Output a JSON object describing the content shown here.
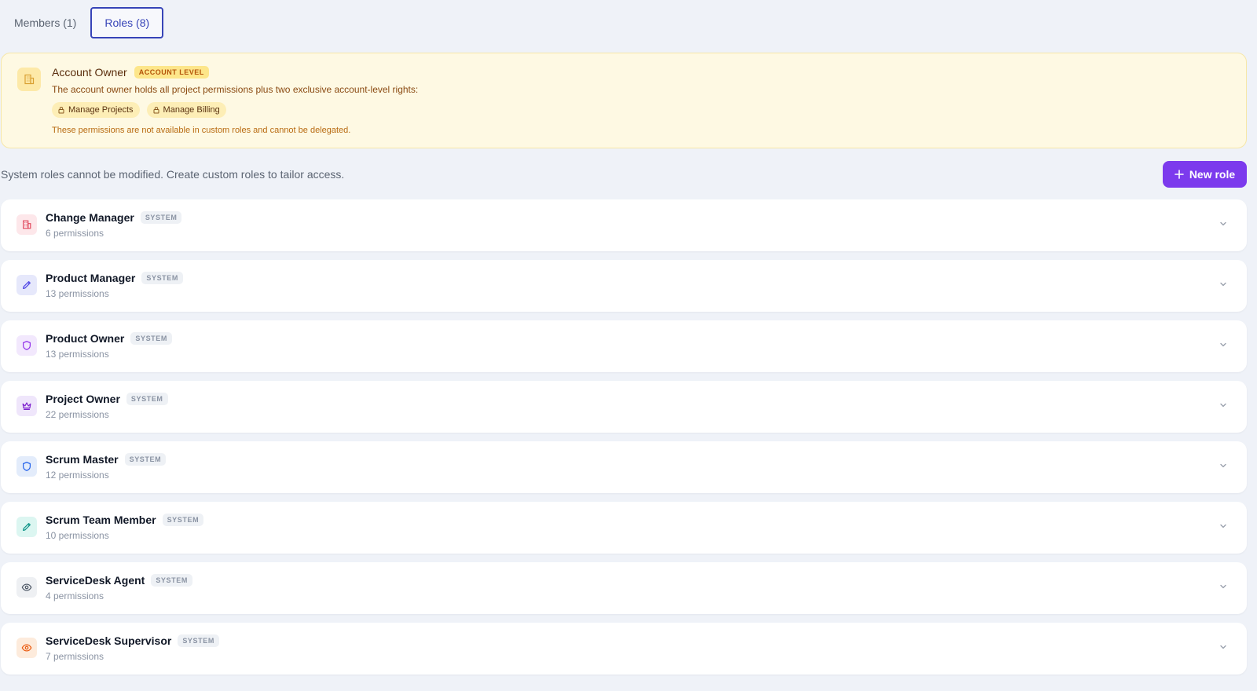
{
  "tabs": [
    {
      "label": "Members (1)",
      "active": false
    },
    {
      "label": "Roles (8)",
      "active": true
    }
  ],
  "account_owner": {
    "title": "Account Owner",
    "badge": "ACCOUNT LEVEL",
    "description": "The account owner holds all project permissions plus two exclusive account-level rights:",
    "rights": [
      "Manage Projects",
      "Manage Billing"
    ],
    "note": "These permissions are not available in custom roles and cannot be delegated.",
    "icon": "building-icon"
  },
  "subheader": "System roles cannot be modified. Create custom roles to tailor access.",
  "new_role_button": "New role",
  "roles": [
    {
      "name": "Change Manager",
      "badge": "SYSTEM",
      "permissions": "6 permissions",
      "icon": "building-icon",
      "icon_color": "#e0455a",
      "icon_bg": "#fde7ea"
    },
    {
      "name": "Product Manager",
      "badge": "SYSTEM",
      "permissions": "13 permissions",
      "icon": "pencil-icon",
      "icon_color": "#4f46e5",
      "icon_bg": "#e6e8fb"
    },
    {
      "name": "Product Owner",
      "badge": "SYSTEM",
      "permissions": "13 permissions",
      "icon": "shield-icon",
      "icon_color": "#9333ea",
      "icon_bg": "#f2e8fd"
    },
    {
      "name": "Project Owner",
      "badge": "SYSTEM",
      "permissions": "22 permissions",
      "icon": "crown-icon",
      "icon_color": "#7e22ce",
      "icon_bg": "#efe6fb"
    },
    {
      "name": "Scrum Master",
      "badge": "SYSTEM",
      "permissions": "12 permissions",
      "icon": "shield-icon",
      "icon_color": "#2563eb",
      "icon_bg": "#e3ecfb"
    },
    {
      "name": "Scrum Team Member",
      "badge": "SYSTEM",
      "permissions": "10 permissions",
      "icon": "pencil-icon",
      "icon_color": "#0d9488",
      "icon_bg": "#dcf6f1"
    },
    {
      "name": "ServiceDesk Agent",
      "badge": "SYSTEM",
      "permissions": "4 permissions",
      "icon": "eye-icon",
      "icon_color": "#4b5563",
      "icon_bg": "#eef0f3"
    },
    {
      "name": "ServiceDesk Supervisor",
      "badge": "SYSTEM",
      "permissions": "7 permissions",
      "icon": "eye-icon",
      "icon_color": "#ea580c",
      "icon_bg": "#fdebdc"
    }
  ],
  "colors": {
    "accent": "#7c3aed",
    "tab_active": "#3744b8",
    "banner_bg": "#fef9e3"
  }
}
